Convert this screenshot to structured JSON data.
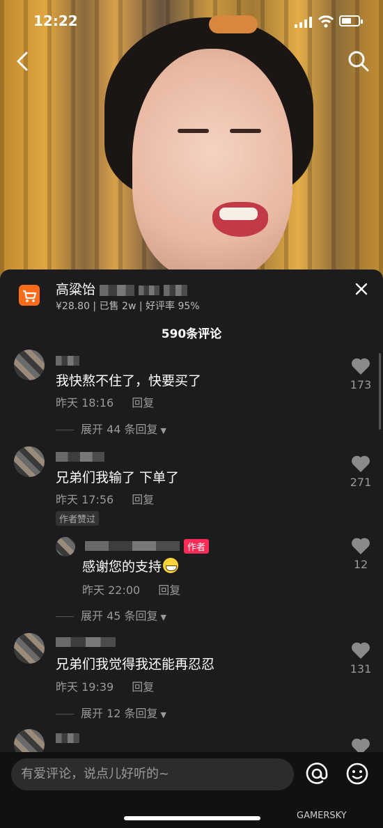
{
  "status": {
    "time": "12:22"
  },
  "product": {
    "title": "高粱饴",
    "meta": "¥28.80 | 已售 2w | 好评率 95%"
  },
  "comments_count": "590条评论",
  "comments": [
    {
      "text": "我快熬不住了，快要买了",
      "time": "昨天 18:16",
      "reply": "回复",
      "likes": "173",
      "expand": "展开 44 条回复"
    },
    {
      "text": "兄弟们我输了 下单了",
      "time": "昨天 17:56",
      "reply": "回复",
      "likes": "271",
      "tag": "作者赞过",
      "sub": {
        "author_badge": "作者",
        "text": "感谢您的支持",
        "time": "昨天 22:00",
        "reply": "回复",
        "likes": "12"
      },
      "expand": "展开 45 条回复"
    },
    {
      "text": "兄弟们我觉得我还能再忍忍",
      "time": "昨天 19:39",
      "reply": "回复",
      "likes": "131",
      "expand": "展开 12 条回复"
    }
  ],
  "input": {
    "placeholder": "有爱评论，说点儿好听的~"
  },
  "watermark": "GAMERSKY",
  "icons": [
    "back-icon",
    "search-icon",
    "cart-icon",
    "close-icon",
    "heart-icon",
    "at-icon",
    "emoji-icon"
  ]
}
